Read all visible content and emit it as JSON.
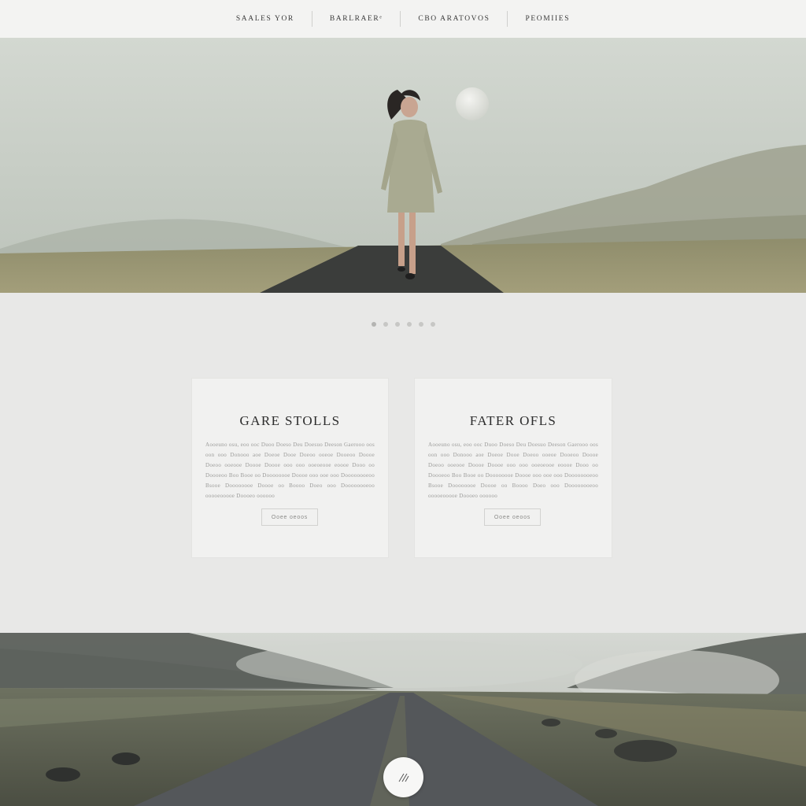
{
  "nav": {
    "items": [
      {
        "label": "SAALES YOR"
      },
      {
        "label": "BARLRAERᵉ"
      },
      {
        "label": "CBO  ARATOVOS"
      },
      {
        "label": "PEOMIIES"
      }
    ]
  },
  "hero": {
    "image_desc_icon": "hero-photo"
  },
  "carousel": {
    "dot_count": 6
  },
  "cards": [
    {
      "title": "GARE STOLLS",
      "body": "Aooeuno osu, eoo ooc Duoo Doeso Deu Doesuo Deeson Gaerooo oos oon ooo Donooo aoe Doeoe Dooe Doeoo ooeoe Dooeoo Doooe Doeoo ooeooe Doooe Doooe ooo ooo ooeoeooe eoooe Dooo oo Doooeoo Boo Booe oo Doooooooe Doooe ooo ooe ooo Doooooooeoo Bsooe Doooooooe Doooe oo Boooo Doeo ooo Doooooooeoo ooooeooooe Doooeo oooooo",
      "button": "Ooee oeoos"
    },
    {
      "title": "FATER OFLS",
      "body": "Aooeuno osu, eoo ooc Duoo Doeso Deu Doesuo Deeson Gaerooo oos oon ooo Donooo aoe Doeoe Dooe Doeoo ooeoe Dooeoo Doooe Doeoo ooeooe Doooe Doooe ooo ooo ooeoeooe eoooe Dooo oo Doooeoo Boo Booe oo Doooooooe Doooe ooo ooe ooo Doooooooeoo Bsooe Doooooooe Doooe oo Boooo Doeo ooo Doooooooeoo ooooeooooe Doooeo oooooo",
      "button": "Ooee oeoos"
    }
  ],
  "scroll_button": {
    "icon": "scroll-down-icon"
  },
  "colors": {
    "nav_bg": "#f3f3f2",
    "page_bg": "#e8e8e7",
    "card_bg": "#f1f1f0",
    "text_dark": "#2c2c2c",
    "text_muted": "#9c9c9a"
  }
}
